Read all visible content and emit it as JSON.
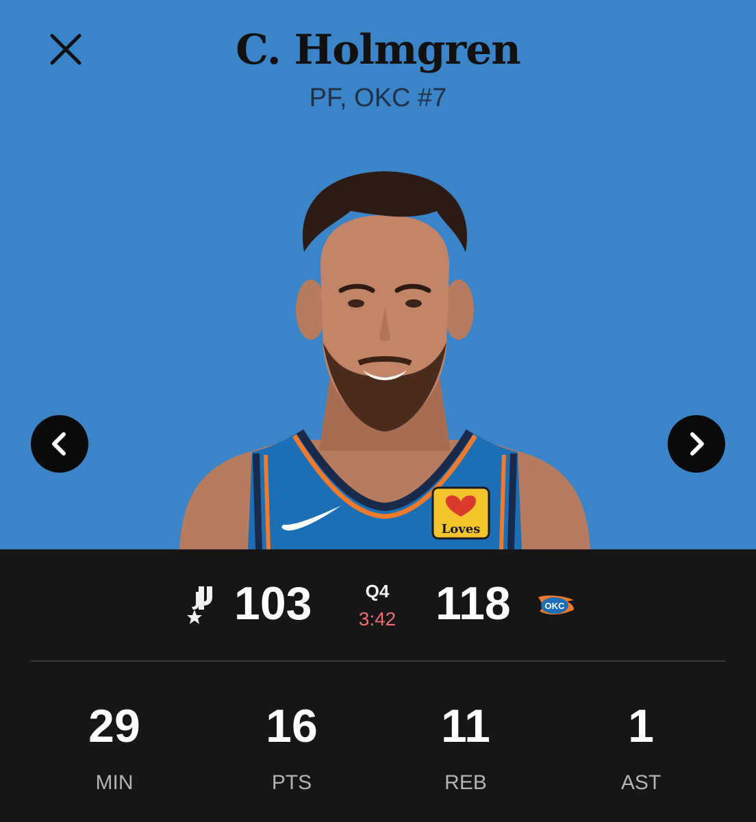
{
  "player": {
    "name": "C. Holmgren",
    "meta": "PF, OKC #7",
    "jersey_sponsor": "Loves"
  },
  "game": {
    "away_team": {
      "logo": "spurs-logo",
      "score": "103"
    },
    "home_team": {
      "logo": "thunder-logo",
      "score": "118",
      "logo_text": "OKC"
    },
    "period": "Q4",
    "clock": "3:42"
  },
  "stats": [
    {
      "value": "29",
      "label": "MIN"
    },
    {
      "value": "16",
      "label": "PTS"
    },
    {
      "value": "11",
      "label": "REB"
    },
    {
      "value": "1",
      "label": "AST"
    }
  ],
  "colors": {
    "hero_background": "#3a84c7",
    "panel_background": "#161616",
    "clock": "#ef6e6e"
  }
}
